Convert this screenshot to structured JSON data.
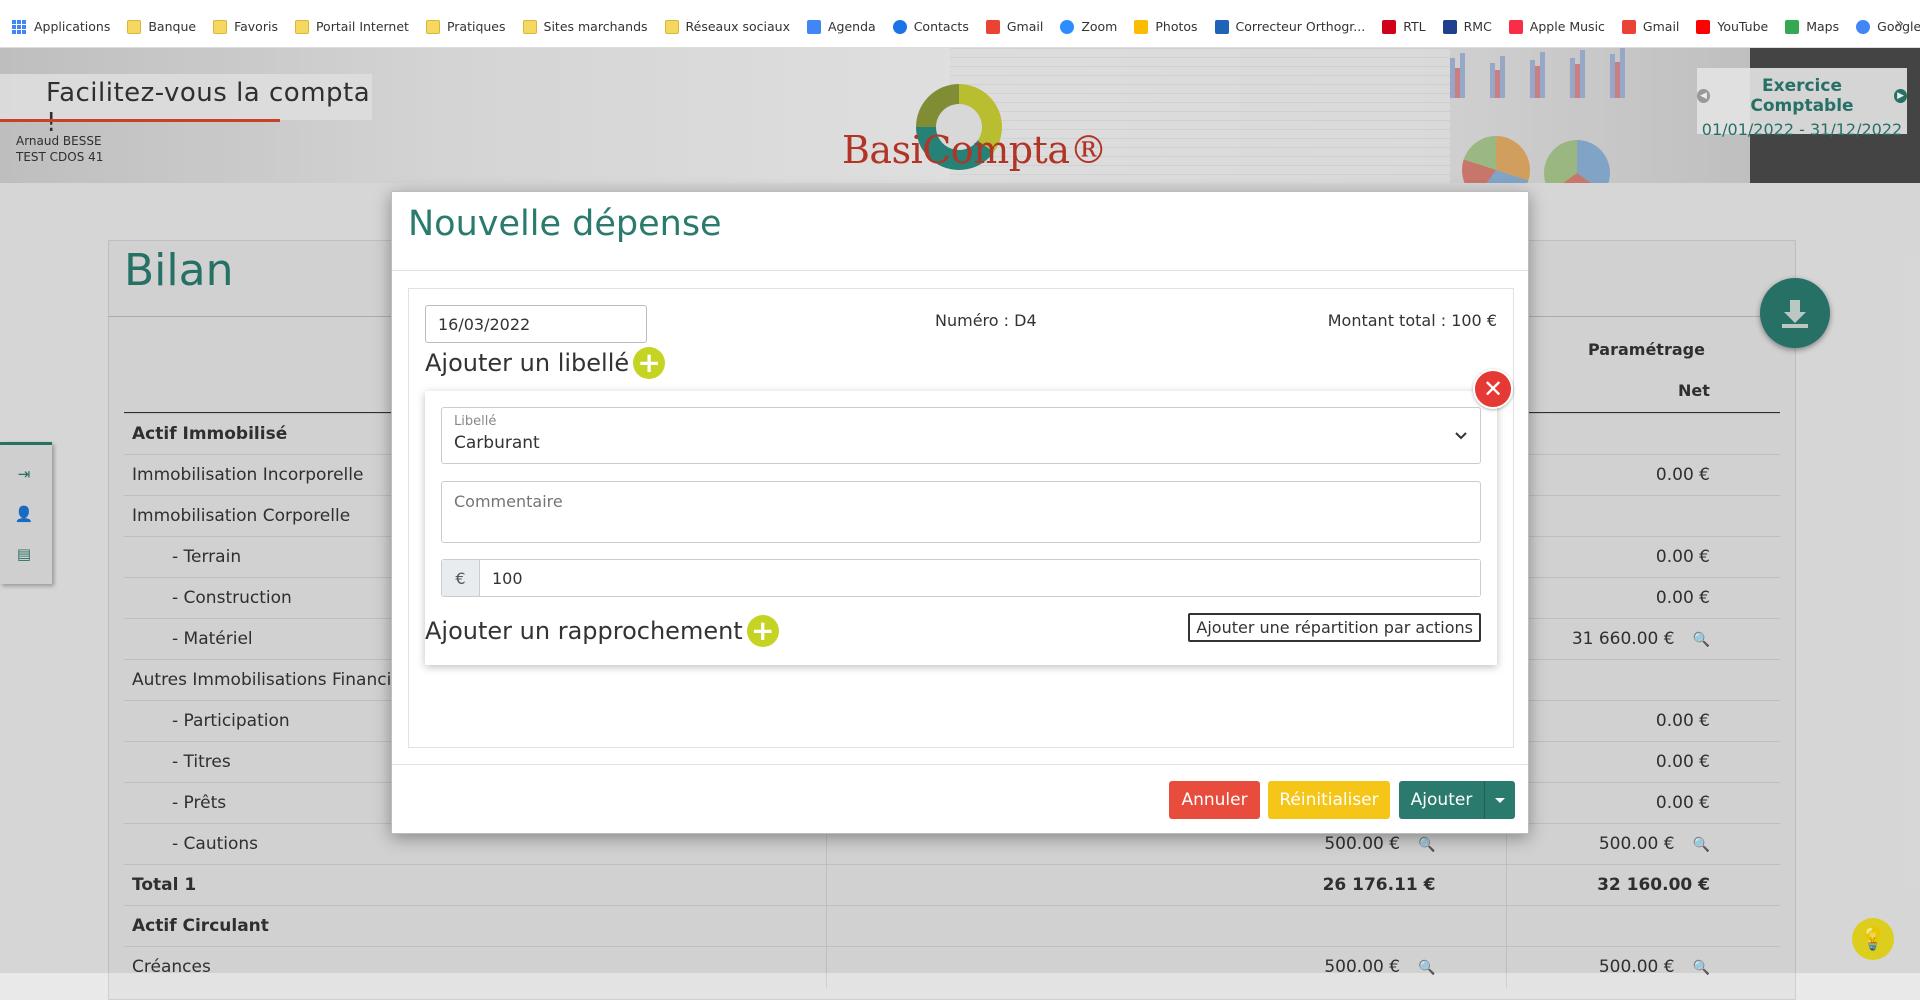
{
  "bookmarks": [
    {
      "label": "Applications",
      "icon": "apps-grid-icon"
    },
    {
      "label": "Banque",
      "icon": "folder-icon"
    },
    {
      "label": "Favoris",
      "icon": "folder-icon"
    },
    {
      "label": "Portail Internet",
      "icon": "folder-icon"
    },
    {
      "label": "Pratiques",
      "icon": "folder-icon"
    },
    {
      "label": "Sites marchands",
      "icon": "folder-icon"
    },
    {
      "label": "Réseaux sociaux",
      "icon": "folder-icon"
    },
    {
      "label": "Agenda",
      "icon": "calendar-icon"
    },
    {
      "label": "Contacts",
      "icon": "contacts-icon"
    },
    {
      "label": "Gmail",
      "icon": "gmail-icon"
    },
    {
      "label": "Zoom",
      "icon": "zoom-icon"
    },
    {
      "label": "Photos",
      "icon": "photos-icon"
    },
    {
      "label": "Correcteur Orthogr...",
      "icon": "correcteur-icon"
    },
    {
      "label": "RTL",
      "icon": "rtl-icon"
    },
    {
      "label": "RMC",
      "icon": "rmc-icon"
    },
    {
      "label": "Apple Music",
      "icon": "apple-music-icon"
    },
    {
      "label": "Gmail",
      "icon": "gmail-icon"
    },
    {
      "label": "YouTube",
      "icon": "youtube-icon"
    },
    {
      "label": "Maps",
      "icon": "maps-icon"
    },
    {
      "label": "Google Alertes",
      "icon": "google-icon"
    }
  ],
  "bookmarks_more": "»",
  "banner": {
    "slogan": "Facilitez-vous la compta !",
    "user_name": "Arnaud BESSE",
    "user_company": "TEST CDOS 41",
    "logo_text": "BasiCompta®",
    "exercise_title": "Exercice Comptable",
    "exercise_dates": "01/01/2022 - 31/12/2022"
  },
  "page": {
    "title": "Bilan",
    "col_param": "Paramétrage",
    "col_net": "Net",
    "rows": [
      {
        "label": "Actif Immobilisé",
        "v1": "",
        "v2": "",
        "style": "strong"
      },
      {
        "label": "Immobilisation Incorporelle",
        "v1": "",
        "v2": "0.00 €"
      },
      {
        "label": "Immobilisation Corporelle",
        "v1": "",
        "v2": ""
      },
      {
        "label": "- Terrain",
        "v1": "",
        "v2": "0.00 €",
        "indent": true
      },
      {
        "label": "- Construction",
        "v1": "",
        "v2": "0.00 €",
        "indent": true
      },
      {
        "label": "- Matériel",
        "v1": "",
        "v2": "31 660.00 €",
        "indent": true,
        "search2": true
      },
      {
        "label": "Autres Immobilisations Financières",
        "v1": "",
        "v2": ""
      },
      {
        "label": "- Participation",
        "v1": "",
        "v2": "0.00 €",
        "indent": true
      },
      {
        "label": "- Titres",
        "v1": "",
        "v2": "0.00 €",
        "indent": true
      },
      {
        "label": "- Prêts",
        "v1": "",
        "v2": "0.00 €",
        "indent": true
      },
      {
        "label": "- Cautions",
        "v1": "500.00 €",
        "v2": "500.00 €",
        "indent": true,
        "search1": true,
        "search2": true
      },
      {
        "label": "Total 1",
        "v1": "26 176.11 €",
        "v2": "32 160.00 €",
        "style": "strong"
      },
      {
        "label": "Actif Circulant",
        "v1": "",
        "v2": "",
        "style": "strong"
      },
      {
        "label": "Créances",
        "v1": "500.00 €",
        "v2": "500.00 €",
        "search1": true,
        "search2": true
      }
    ]
  },
  "modal": {
    "title": "Nouvelle dépense",
    "date_value": "16/03/2022",
    "numero": "Numéro : D4",
    "montant": "Montant total : 100 €",
    "add_libelle": "Ajouter un libellé",
    "libelle_label": "Libellé",
    "libelle_value": "Carburant",
    "comment_placeholder": "Commentaire",
    "currency": "€",
    "amount_value": "100",
    "repartition_button": "Ajouter une répartition par actions",
    "add_rapprochement": "Ajouter un rapprochement",
    "btn_annuler": "Annuler",
    "btn_reinit": "Réinitialiser",
    "btn_ajouter": "Ajouter"
  },
  "colors": {
    "brand_teal": "#2a7a6e",
    "add_green": "#c5d322",
    "danger": "#e74c3c",
    "warning": "#f5c518"
  }
}
